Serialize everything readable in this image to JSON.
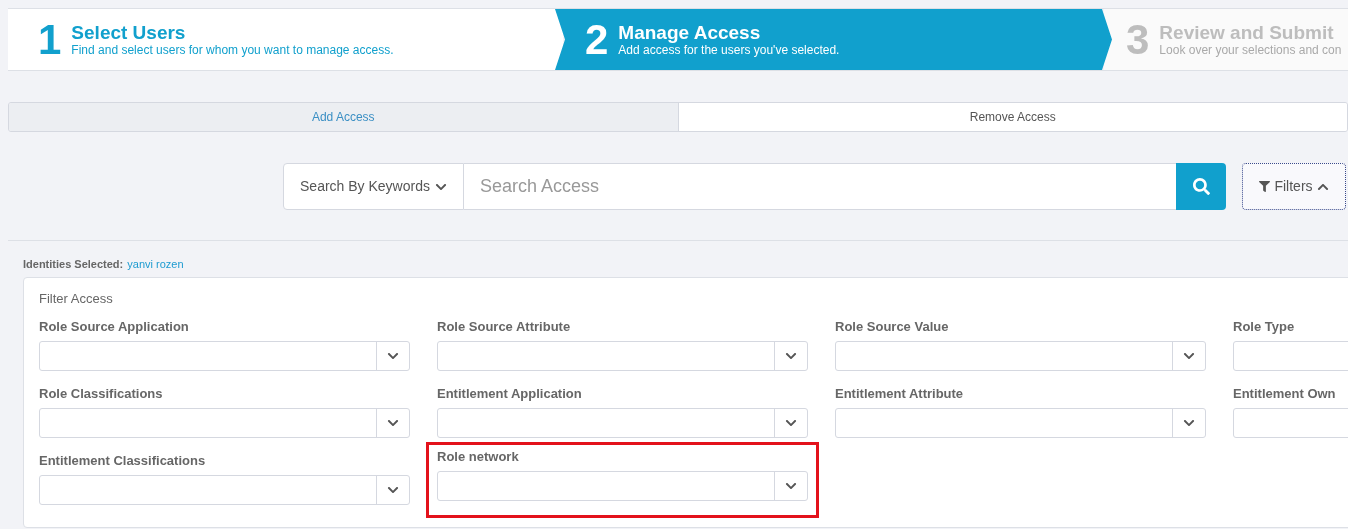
{
  "steps": [
    {
      "number": "1",
      "title": "Select Users",
      "subtitle": "Find and select users for whom you want to manage access.",
      "kind": "done"
    },
    {
      "number": "2",
      "title": "Manage Access",
      "subtitle": "Add access for the users you've selected.",
      "kind": "current"
    },
    {
      "number": "3",
      "title": "Review and Submit",
      "subtitle": "Look over your selections and con",
      "kind": "upcoming"
    }
  ],
  "tabs": [
    {
      "label": "Add Access",
      "selected": true
    },
    {
      "label": "Remove Access",
      "selected": false
    }
  ],
  "search": {
    "mode": "Search By Keywords",
    "placeholder": "Search Access",
    "filters_button": "Filters",
    "filters_expanded": true
  },
  "identities": {
    "label": "Identities Selected:",
    "value": "yanvi rozen"
  },
  "filter_panel": {
    "title": "Filter Access",
    "fields": [
      {
        "label": "Role Source Application",
        "highlighted": false
      },
      {
        "label": "Role Source Attribute",
        "highlighted": false
      },
      {
        "label": "Role Source Value",
        "highlighted": false
      },
      {
        "label": "Role Type",
        "highlighted": false
      },
      {
        "label": "Role Classifications",
        "highlighted": false
      },
      {
        "label": "Entitlement Application",
        "highlighted": false
      },
      {
        "label": "Entitlement Attribute",
        "highlighted": false
      },
      {
        "label": "Entitlement Own",
        "highlighted": false
      },
      {
        "label": "Entitlement Classifications",
        "highlighted": false
      },
      {
        "label": "Role network",
        "highlighted": true
      }
    ]
  }
}
